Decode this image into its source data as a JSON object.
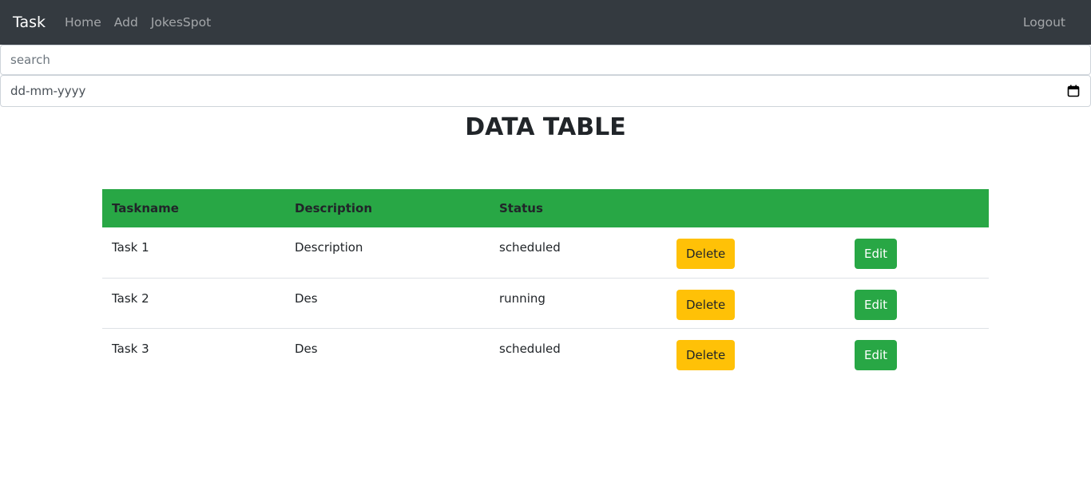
{
  "navbar": {
    "brand": "Task",
    "links": [
      {
        "label": "Home"
      },
      {
        "label": "Add"
      },
      {
        "label": "JokesSpot"
      }
    ],
    "logout_label": "Logout"
  },
  "search": {
    "placeholder": "search",
    "value": ""
  },
  "date_filter": {
    "placeholder": "dd-mm-yyyy",
    "icon": "calendar-icon"
  },
  "page_title": "DATA TABLE",
  "table": {
    "header_color": "#28a745",
    "columns": [
      "Taskname",
      "Description",
      "Status",
      "",
      ""
    ],
    "rows": [
      {
        "taskname": "Task 1",
        "description": "Description",
        "status": "scheduled",
        "delete_label": "Delete",
        "edit_label": "Edit"
      },
      {
        "taskname": "Task 2",
        "description": "Des",
        "status": "running",
        "delete_label": "Delete",
        "edit_label": "Edit"
      },
      {
        "taskname": "Task 3",
        "description": "Des",
        "status": "scheduled",
        "delete_label": "Delete",
        "edit_label": "Edit"
      }
    ]
  },
  "colors": {
    "navbar_bg": "#343a40",
    "delete_button": "#ffc107",
    "edit_button": "#28a745"
  }
}
